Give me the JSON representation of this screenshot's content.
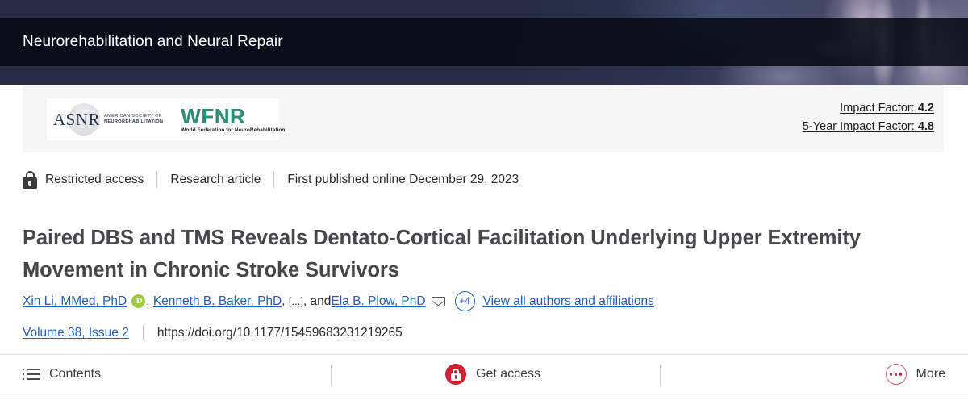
{
  "header": {
    "journal_title": "Neurorehabilitation and Neural Repair"
  },
  "society_strip": {
    "logos": [
      {
        "name": "ASNR",
        "wordmark": "ASNR",
        "line1": "AMERICAN SOCIETY OF",
        "line2": "NEUROREHABILITATION"
      },
      {
        "name": "WFNR",
        "wordmark": "WFNR",
        "tagline": "World Federation for NeuroRehabilitation"
      }
    ],
    "impact_factor_label": "Impact Factor:",
    "impact_factor_value": "4.2",
    "five_year_label": "5-Year Impact Factor:",
    "five_year_value": "4.8"
  },
  "meta": {
    "access_status": "Restricted access",
    "article_type": "Research article",
    "publication_date": "First published online December 29, 2023"
  },
  "article": {
    "title": "Paired DBS and TMS Reveals Dentato-Cortical Facilitation Underlying Upper Extremity Movement in Chronic Stroke Survivors"
  },
  "authors": {
    "first": "Xin Li, MMed, PhD",
    "second": "Kenneth B. Baker, PhD",
    "ellipsis": "[...]",
    "conjunction": ", and ",
    "last": "Ela B. Plow, PhD",
    "more_count": "+4",
    "view_all_label": "View all authors and affiliations",
    "orcid_label": "iD"
  },
  "publication": {
    "volume_issue": "Volume 38, Issue 2",
    "doi": "https://doi.org/10.1177/15459683231219265"
  },
  "toolbar": {
    "contents_label": "Contents",
    "get_access_label": "Get access",
    "more_label": "More"
  },
  "colors": {
    "header_navy": "#272c44",
    "link_blue": "#1f5fbf",
    "orcid_green": "#9ccb3b",
    "access_red": "#cf2233",
    "wfnr_green": "#2f8e72"
  }
}
